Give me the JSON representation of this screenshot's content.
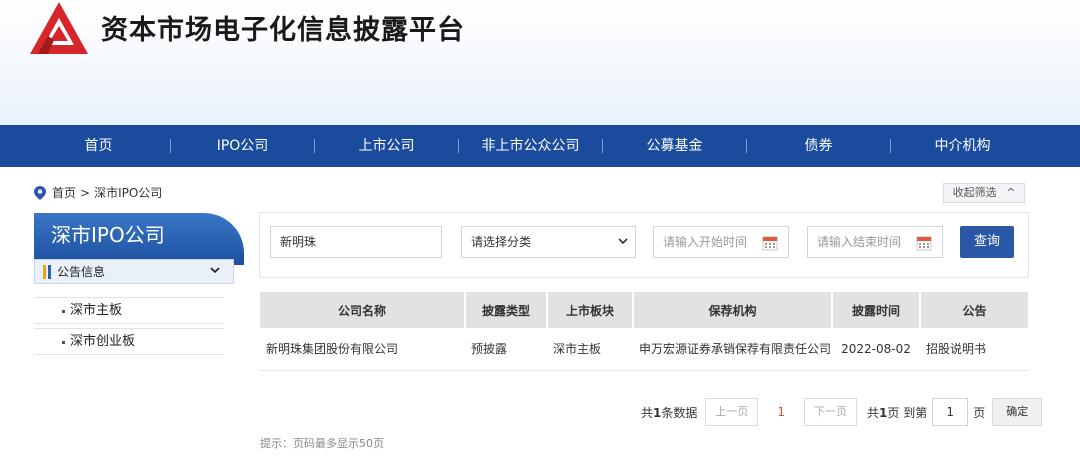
{
  "header": {
    "title": "资本市场电子化信息披露平台"
  },
  "nav": {
    "items": [
      {
        "label": "首页"
      },
      {
        "label": "IPO公司"
      },
      {
        "label": "上市公司"
      },
      {
        "label": "非上市公众公司"
      },
      {
        "label": "公募基金"
      },
      {
        "label": "债券"
      },
      {
        "label": "中介机构"
      }
    ]
  },
  "breadcrumb": {
    "home": "首页",
    "sep": ">",
    "current": "深市IPO公司"
  },
  "collapse": {
    "label": "收起筛选",
    "icon": "chevron-up-icon",
    "glyph": "^"
  },
  "sidebar": {
    "title": "深市IPO公司",
    "section": "公告信息",
    "items": [
      {
        "label": "深市主板"
      },
      {
        "label": "深市创业板"
      }
    ]
  },
  "filter": {
    "keyword": "新明珠",
    "category": "请选择分类",
    "start_placeholder": "请输入开始时间",
    "end_placeholder": "请输入结束时间",
    "search_label": "查询"
  },
  "table": {
    "headers": [
      "公司名称",
      "披露类型",
      "上市板块",
      "保荐机构",
      "披露时间",
      "公告"
    ],
    "rows": [
      [
        "新明珠集团股份有限公司",
        "预披露",
        "深市主板",
        "申万宏源证券承销保荐有限责任公司",
        "2022-08-02",
        "招股说明书"
      ]
    ]
  },
  "pager": {
    "total_prefix": "共",
    "total_count": "1",
    "total_suffix": "条数据",
    "prev": "上一页",
    "current": "1",
    "next": "下一页",
    "pages_prefix": "共",
    "pages_count": "1",
    "pages_suffix": "页 到第",
    "goto_value": "1",
    "page_unit": "页",
    "confirm": "确定"
  },
  "hint": "提示：页码最多显示50页",
  "colors": {
    "nav_bg": "#1a4b9d",
    "button": "#2a57a6",
    "logo_red": "#d7262b",
    "current_page": "#e74a3b"
  }
}
